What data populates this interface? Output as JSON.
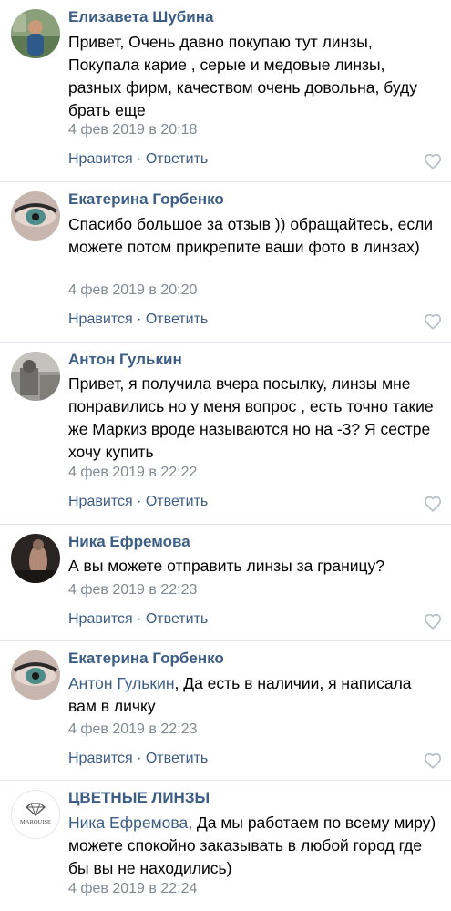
{
  "comments": [
    {
      "author": "Елизавета Шубина",
      "text": "Привет, Очень давно покупаю тут линзы, Покупала карие , серые и медовые линзы, разных фирм, качеством очень довольна, буду брать еще",
      "date": "4 фев 2019 в 20:18",
      "like_label": "Нравится",
      "reply_label": "Ответить"
    },
    {
      "author": "Екатерина Горбенко",
      "text": "Спасибо большое за отзыв )) обращайтесь, если можете потом прикрепите ваши фото в линзах)",
      "date": "4 фев 2019 в 20:20",
      "like_label": "Нравится",
      "reply_label": "Ответить"
    },
    {
      "author": "Антон Гулькин",
      "text": "Привет, я получила вчера посылку, линзы мне понравились но у меня вопрос , есть точно такие же Маркиз вроде называются но на -3? Я сестре хочу купить",
      "date": "4 фев 2019 в 22:22",
      "like_label": "Нравится",
      "reply_label": "Ответить"
    },
    {
      "author": "Ника Ефремова",
      "text": "А вы можете отправить линзы за границу?",
      "date": "4 фев 2019 в 22:23",
      "like_label": "Нравится",
      "reply_label": "Ответить"
    },
    {
      "author": "Екатерина Горбенко",
      "mention": "Антон Гулькин",
      "text": ", Да есть в наличии, я написала вам в личку",
      "date": "4 фев 2019 в 22:23",
      "like_label": "Нравится",
      "reply_label": "Ответить"
    },
    {
      "author": "ЦВЕТНЫЕ ЛИНЗЫ",
      "mention": "Ника Ефремова",
      "text": ", Да мы работаем по всему миру) можете спокойно заказывать в любой город где бы вы не находились)",
      "date": "4 фев 2019 в 22:24",
      "avatar_logo_text": "MARQUISE"
    }
  ],
  "separator": "·",
  "colors": {
    "link": "#3c5d85",
    "muted": "#828a93",
    "divider": "#e3e6ea"
  },
  "icons": {
    "like": "heart-icon"
  }
}
